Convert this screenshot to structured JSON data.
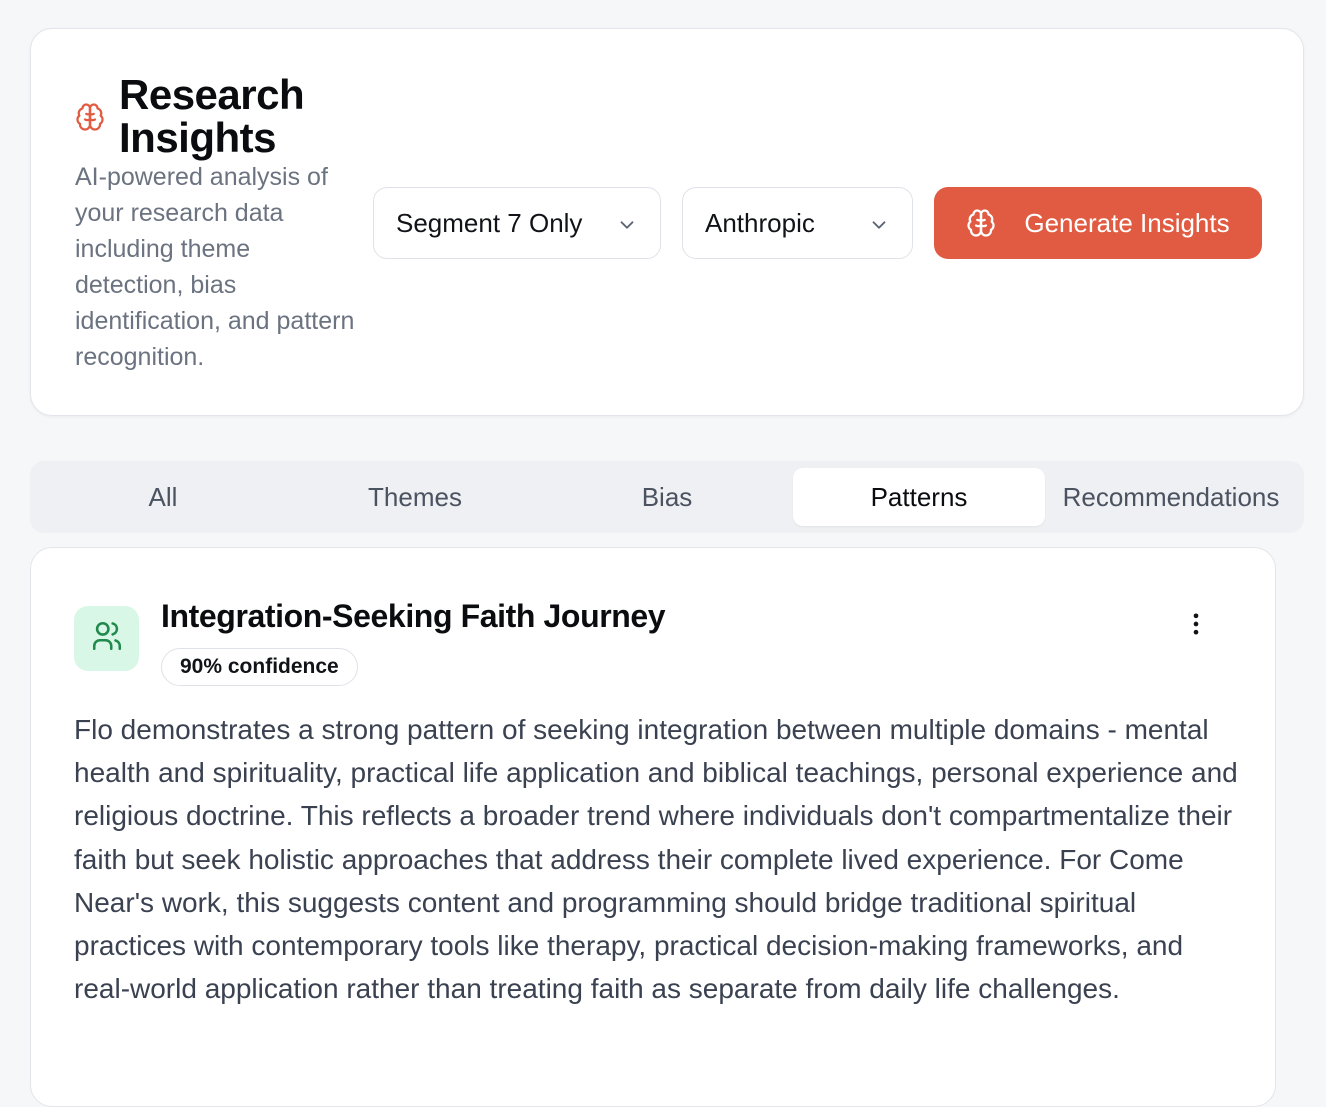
{
  "header": {
    "icon": "brain-icon",
    "title": "Research Insights",
    "description": "AI-powered analysis of your research data including theme detection, bias identification, and pattern recognition.",
    "segment_select": {
      "value": "Segment 7 Only",
      "icon": "chevron-down-icon"
    },
    "provider_select": {
      "value": "Anthropic",
      "icon": "chevron-down-icon"
    },
    "generate_button": {
      "label": "Generate Insights",
      "icon": "brain-icon"
    }
  },
  "tabs": [
    {
      "label": "All",
      "active": false
    },
    {
      "label": "Themes",
      "active": false
    },
    {
      "label": "Bias",
      "active": false
    },
    {
      "label": "Patterns",
      "active": true
    },
    {
      "label": "Recommendations",
      "active": false
    }
  ],
  "insight": {
    "icon": "users-icon",
    "title": "Integration-Seeking Faith Journey",
    "confidence": "90% confidence",
    "body": "Flo demonstrates a strong pattern of seeking integration between multiple domains - mental health and spirituality, practical life application and biblical teachings, personal experience and religious doctrine. This reflects a broader trend where individuals don't compartmentalize their faith but seek holistic approaches that address their complete lived experience. For Come Near's work, this suggests content and programming should bridge traditional spiritual practices with contemporary tools like therapy, practical decision-making frameworks, and real-world application rather than treating faith as separate from daily life challenges.",
    "menu_icon": "more-vertical-icon"
  },
  "colors": {
    "accent": "#e05b41",
    "badge_bg": "#d9f7e6",
    "badge_fg": "#1f8a4c",
    "page_bg": "#f6f7f9"
  }
}
